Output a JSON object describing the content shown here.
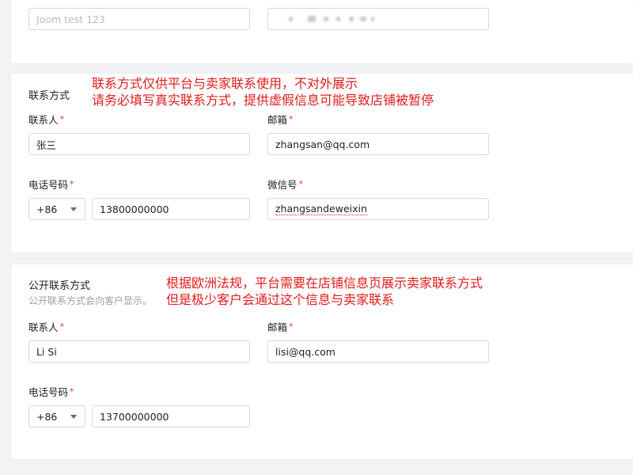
{
  "top_card": {
    "store_name_value": "Joom test 123"
  },
  "contact_section": {
    "title": "联系方式",
    "annotation_line1": "联系方式仅供平台与卖家联系使用，不对外展示",
    "annotation_line2": "请务必填写真实联系方式，提供虚假信息可能导致店铺被暂停",
    "contact_person_label": "联系人",
    "contact_person_value": "张三",
    "email_label": "邮箱",
    "email_value": "zhangsan@qq.com",
    "phone_label": "电话号码",
    "phone_code": "+86",
    "phone_value": "13800000000",
    "wechat_label": "微信号",
    "wechat_value": "zhangsandeweixin"
  },
  "public_section": {
    "title": "公开联系方式",
    "subtitle": "公开联系方式会向客户显示。",
    "annotation_line1": "根据欧洲法规，平台需要在店铺信息页展示卖家联系方式",
    "annotation_line2": "但是极少客户会通过这个信息与卖家联系",
    "contact_person_label": "联系人",
    "contact_person_value": "Li Si",
    "email_label": "邮箱",
    "email_value": "lisi@qq.com",
    "phone_label": "电话号码",
    "phone_code": "+86",
    "phone_value": "13700000000"
  },
  "required_mark": "*",
  "colors": {
    "annotation": "#e11b1b",
    "required": "#e53935",
    "background": "#f2f3f5",
    "border": "#d5d7dc"
  }
}
